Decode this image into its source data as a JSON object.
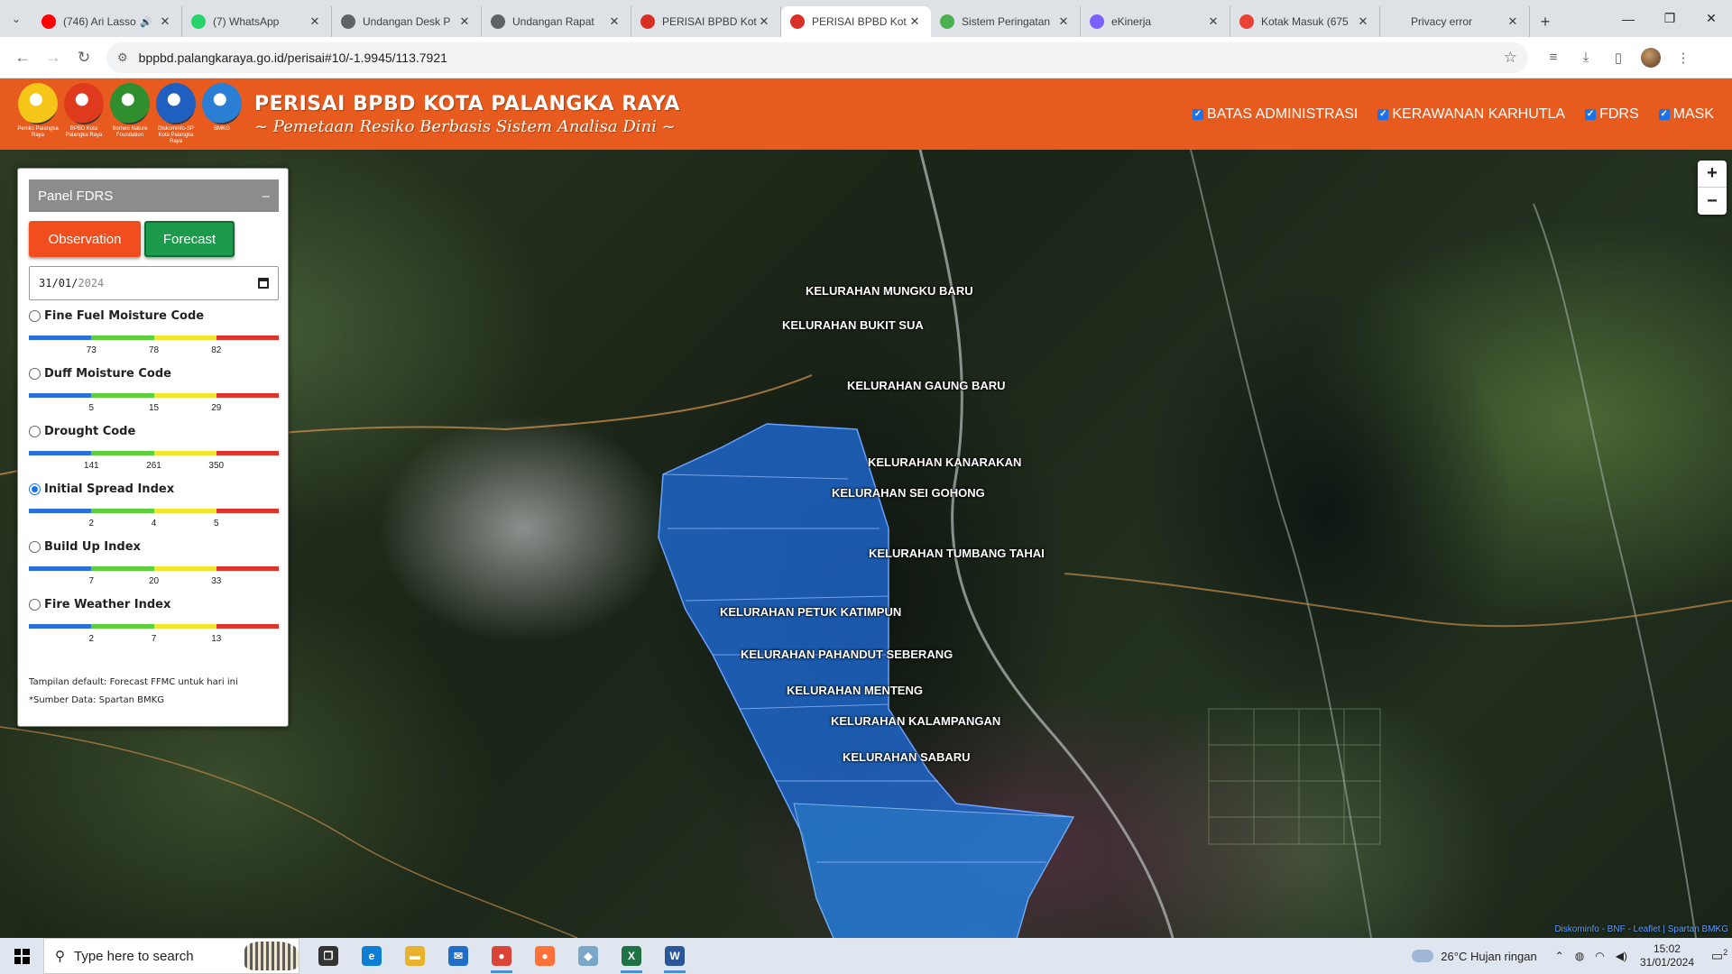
{
  "browser": {
    "tabs": [
      {
        "title": "(746) Ari Lasso",
        "favicon": "youtube-icon",
        "color": "#ff0000",
        "audio": true
      },
      {
        "title": "(7) WhatsApp",
        "favicon": "whatsapp-icon",
        "color": "#25d366"
      },
      {
        "title": "Undangan Desk P",
        "favicon": "globe-icon",
        "color": "#5f6368"
      },
      {
        "title": "Undangan Rapat",
        "favicon": "globe-icon",
        "color": "#5f6368"
      },
      {
        "title": "PERISAI BPBD Kot",
        "favicon": "bpbd-icon",
        "color": "#d93025"
      },
      {
        "title": "PERISAI BPBD Kot",
        "favicon": "bpbd-icon",
        "color": "#d93025",
        "active": true
      },
      {
        "title": "Sistem Peringatan",
        "favicon": "sistem-icon",
        "color": "#4caf50"
      },
      {
        "title": "eKinerja",
        "favicon": "ekinerja-icon",
        "color": "#7b61ff"
      },
      {
        "title": "Kotak Masuk (675",
        "favicon": "gmail-icon",
        "color": "#ea4335"
      },
      {
        "title": "Privacy error",
        "favicon": "",
        "color": "#5f6368"
      }
    ],
    "url": "bppbd.palangkaraya.go.id/perisai#10/-1.9945/113.7921"
  },
  "header": {
    "title": "PERISAI BPBD KOTA PALANGKA RAYA",
    "subtitle": "~ Pemetaan Resiko Berbasis Sistem Analisa Dini ~",
    "logos": [
      {
        "caption": "Pemko Palangka Raya",
        "color": "#f5c518"
      },
      {
        "caption": "BPBD Kota Palangka Raya",
        "color": "#e03a1e"
      },
      {
        "caption": "Borneo Nature Foundation",
        "color": "#2f8f2f"
      },
      {
        "caption": "Diskominfo-SP Kota Palangka Raya",
        "color": "#1e5fbf"
      },
      {
        "caption": "BMKG",
        "color": "#2a7fd4"
      }
    ],
    "layers": [
      {
        "label": "BATAS ADMINISTRASI",
        "checked": true
      },
      {
        "label": "KERAWANAN KARHUTLA",
        "checked": true
      },
      {
        "label": "FDRS",
        "checked": true
      },
      {
        "label": "MASK",
        "checked": true
      }
    ]
  },
  "panel": {
    "title": "Panel FDRS",
    "collapse": "–",
    "observation_label": "Observation",
    "forecast_label": "Forecast",
    "date": {
      "day": "31",
      "month": "01",
      "year": "2024"
    },
    "indices": [
      {
        "label": "Fine Fuel Moisture Code",
        "ticks": [
          "73",
          "78",
          "82"
        ],
        "selected": false
      },
      {
        "label": "Duff Moisture Code",
        "ticks": [
          "5",
          "15",
          "29"
        ],
        "selected": false
      },
      {
        "label": "Drought Code",
        "ticks": [
          "141",
          "261",
          "350"
        ],
        "selected": false
      },
      {
        "label": "Initial Spread Index",
        "ticks": [
          "2",
          "4",
          "5"
        ],
        "selected": true
      },
      {
        "label": "Build Up Index",
        "ticks": [
          "7",
          "20",
          "33"
        ],
        "selected": false
      },
      {
        "label": "Fire Weather Index",
        "ticks": [
          "2",
          "7",
          "13"
        ],
        "selected": false
      }
    ],
    "scale_colors": [
      "#2a6fdb",
      "#5cd03a",
      "#f2e530",
      "#e0342a"
    ],
    "footer_line1": "Tampilan default: Forecast FFMC untuk hari ini",
    "footer_line2": "*Sumber Data: Spartan BMKG"
  },
  "map": {
    "kelurahan": [
      "KELURAHAN MUNGKU BARU",
      "KELURAHAN BUKIT SUA",
      "KELURAHAN GAUNG BARU",
      "KELURAHAN KANARAKAN",
      "KELURAHAN SEI GOHONG",
      "KELURAHAN TUMBANG TAHAI",
      "KELURAHAN PETUK KATIMPUN",
      "KELURAHAN PAHANDUT SEBERANG",
      "KELURAHAN MENTENG",
      "KELURAHAN KALAMPANGAN",
      "KELURAHAN SABARU"
    ],
    "zoom_in": "+",
    "zoom_out": "−",
    "attribution": "Diskominfo - BNF - Leaflet | Spartan BMKG"
  },
  "taskbar": {
    "search_placeholder": "Type here to search",
    "apps": [
      {
        "name": "task-view-icon",
        "glyph": "❐",
        "color": "#333"
      },
      {
        "name": "edge-icon",
        "glyph": "e",
        "color": "#0c7fd4"
      },
      {
        "name": "file-explorer-icon",
        "glyph": "▬",
        "color": "#e8b22c"
      },
      {
        "name": "mail-icon",
        "glyph": "✉",
        "color": "#1f6fc9"
      },
      {
        "name": "chrome-icon",
        "glyph": "●",
        "color": "#db4437",
        "running": true
      },
      {
        "name": "firefox-icon",
        "glyph": "●",
        "color": "#ff7139"
      },
      {
        "name": "unknown-app-icon",
        "glyph": "◆",
        "color": "#7aa6c8"
      },
      {
        "name": "excel-icon",
        "glyph": "X",
        "color": "#1f7244",
        "running": true
      },
      {
        "name": "word-icon",
        "glyph": "W",
        "color": "#2b579a",
        "running": true
      }
    ],
    "weather": "26°C  Hujan ringan",
    "time": "15:02",
    "date": "31/01/2024",
    "notification_count": "2"
  }
}
